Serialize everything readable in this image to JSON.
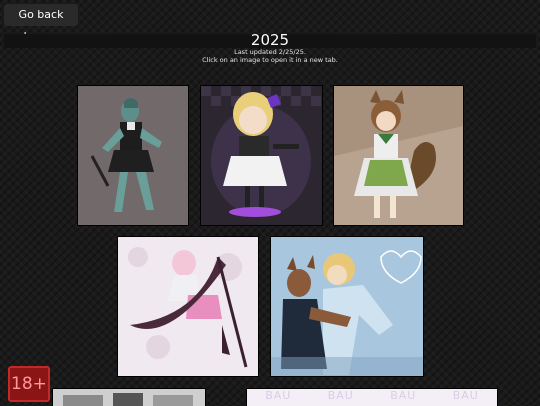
{
  "nav": {
    "back_label": "Go back home."
  },
  "header": {
    "year": "2025",
    "updated": "Last updated 2/25/25.",
    "hint": "Click on an image to open it in a new tab."
  },
  "gallery": {
    "row1_count": 3,
    "row2_count": 2,
    "row3_partial": [
      "BAU",
      "BAU",
      "BAU",
      "BAU"
    ]
  },
  "badge": {
    "label": "18+"
  },
  "colors": {
    "background": "#1a1a1a",
    "title_bar": "#121212",
    "badge_bg": "#8b1414",
    "badge_text": "#ff9a9a"
  }
}
